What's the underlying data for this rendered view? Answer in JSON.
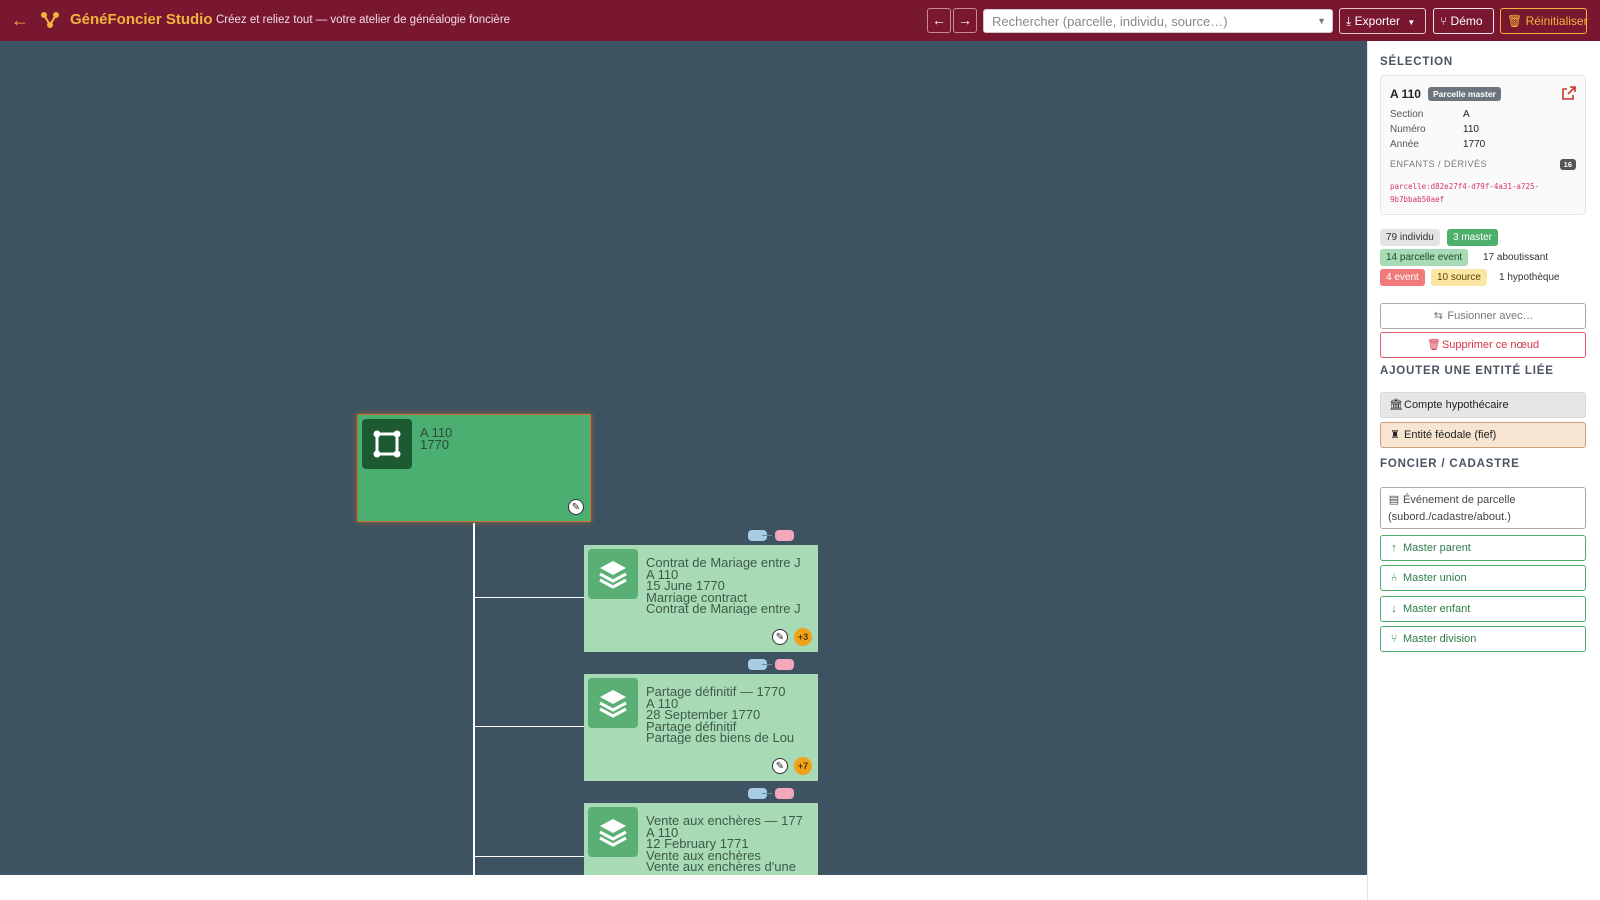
{
  "header": {
    "app_title": "GénéFoncier Studio",
    "tagline": "Créez et reliez tout — votre atelier de généalogie foncière",
    "search_placeholder": "Rechercher (parcelle, individu, source…)",
    "export_label": "Exporter",
    "demo_label": "Démo",
    "reset_label": "Réinitialiser",
    "accent_color": "#7a1730",
    "highlight_color": "#f0b43c"
  },
  "canvas": {
    "master_node": {
      "line1": "A 110",
      "line2": "1770"
    },
    "events": [
      {
        "line1": "Contrat de Mariage entre J",
        "line2": "A 110",
        "line3": "15 June 1770",
        "line4": "Marriage contract",
        "line5": "Contrat de Mariage entre J",
        "extra": "+3"
      },
      {
        "line1": "Partage définitif — 1770",
        "line2": "A 110",
        "line3": "28 September 1770",
        "line4": "Partage définitif",
        "line5": "Partage des biens de Lou",
        "extra": "+7"
      },
      {
        "line1": "Vente aux enchères — 177",
        "line2": "A 110",
        "line3": "12 February 1771",
        "line4": "Vente aux enchères",
        "line5": "Vente aux enchères d'une",
        "extra": ""
      }
    ]
  },
  "sidebar": {
    "selection_title": "SÉLECTION",
    "card": {
      "title": "A 110",
      "badge": "Parcelle master",
      "fields": [
        {
          "key": "Section",
          "value": "A"
        },
        {
          "key": "Numéro",
          "value": "110"
        },
        {
          "key": "Année",
          "value": "1770"
        }
      ],
      "children_label": "ENFANTS / DÉRIVÉS",
      "children_count": "16",
      "uuid": "parcelle:d82e27f4-d79f-4a31-a725-9b7bbab50aef"
    },
    "stats": {
      "individu": "79 individu",
      "master": "3 master",
      "parcelle_event": "14 parcelle event",
      "aboutissant": "17 aboutissant",
      "event": "4 event",
      "source": "10 source",
      "hypotheque": "1 hypothèque"
    },
    "merge_label": "Fusionner avec…",
    "delete_label": "Supprimer ce nœud",
    "add_title": "AJOUTER UNE ENTITÉ LIÉE",
    "compte_label": "Compte hypothécaire",
    "fief_label": "Entité féodale (fief)",
    "foncier_title": "FONCIER / CADASTRE",
    "event_parcelle_label": "Événement de parcelle (subord./cadastre/about.)",
    "master_parent_label": "Master parent",
    "master_union_label": "Master union",
    "master_enfant_label": "Master enfant",
    "master_division_label": "Master division"
  }
}
